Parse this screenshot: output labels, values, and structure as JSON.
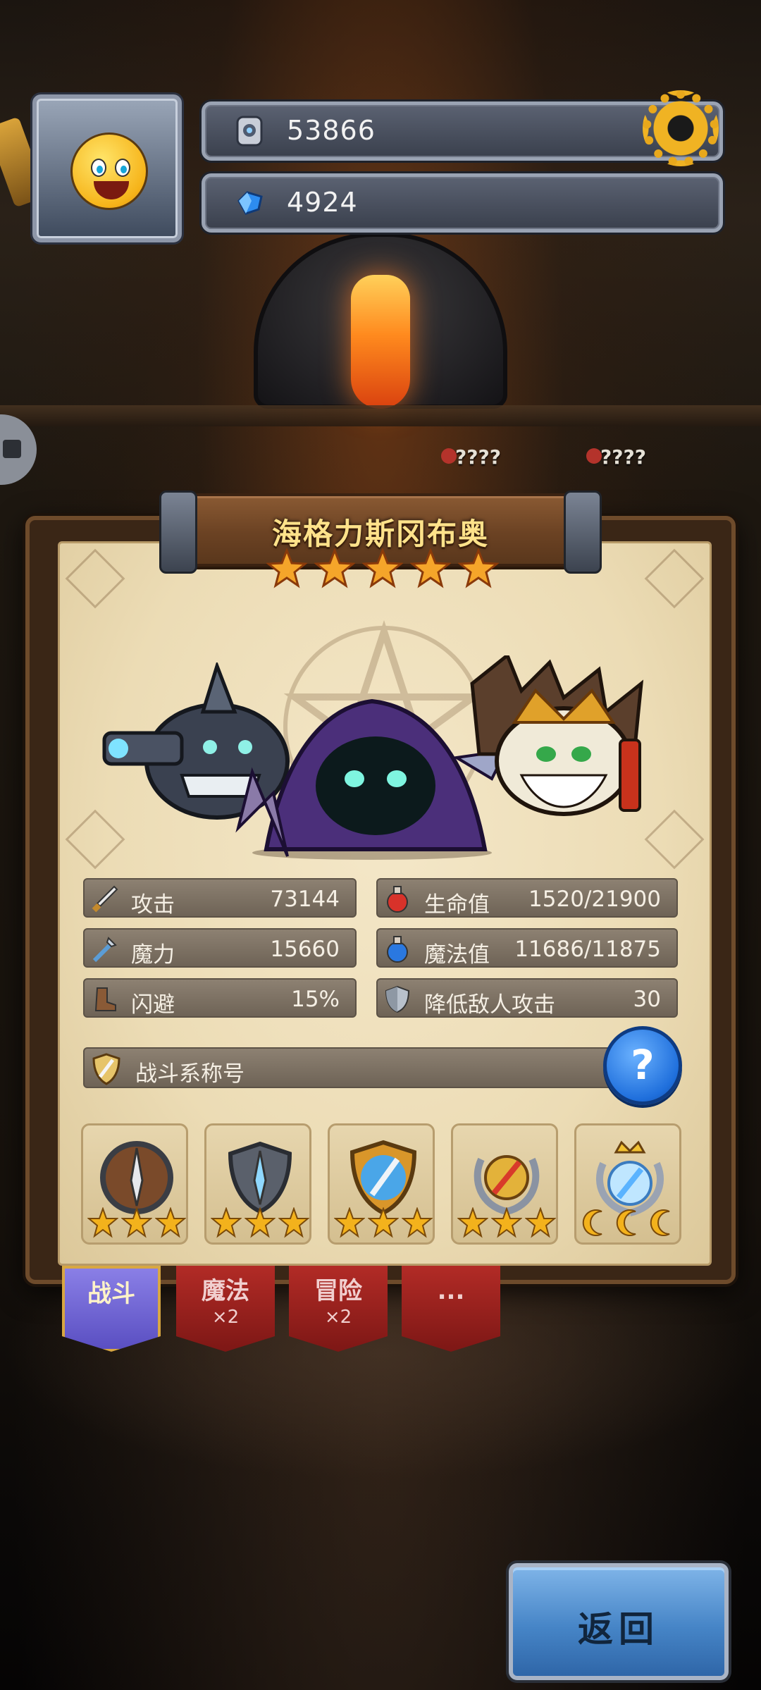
{
  "hud": {
    "currency_1": "53866",
    "currency_1_icon": "silver-token-icon",
    "currency_2": "4924",
    "currency_2_icon": "blue-crystal-icon"
  },
  "background_hints": [
    "????",
    "????"
  ],
  "hero": {
    "name": "海格力斯冈布奥",
    "stars": 5
  },
  "stats": [
    {
      "label": "攻击",
      "value": "73144",
      "icon": "sword-icon"
    },
    {
      "label": "生命值",
      "value": "1520/21900",
      "icon": "red-potion-icon"
    },
    {
      "label": "魔力",
      "value": "15660",
      "icon": "magic-staff-icon"
    },
    {
      "label": "魔法值",
      "value": "11686/11875",
      "icon": "blue-potion-icon"
    },
    {
      "label": "闪避",
      "value": "15%",
      "icon": "boot-icon"
    },
    {
      "label": "降低敌人攻击",
      "value": "30",
      "icon": "shield-icon"
    }
  ],
  "battle_title": {
    "label": "战斗系称号",
    "help": "?"
  },
  "badges": [
    {
      "emblem": "dagger-wood-shield-icon",
      "stars": 3,
      "star_type": "star"
    },
    {
      "emblem": "dagger-steel-shield-icon",
      "stars": 3,
      "star_type": "star"
    },
    {
      "emblem": "sword-gold-shield-icon",
      "stars": 3,
      "star_type": "star"
    },
    {
      "emblem": "sword-laurel-icon",
      "stars": 3,
      "star_type": "star"
    },
    {
      "emblem": "crowned-laurel-icon",
      "stars": 3,
      "star_type": "moon"
    }
  ],
  "tabs": [
    {
      "label": "战斗",
      "mult": "",
      "active": true
    },
    {
      "label": "魔法",
      "mult": "×2",
      "active": false
    },
    {
      "label": "冒险",
      "mult": "×2",
      "active": false
    },
    {
      "label": "...",
      "mult": "",
      "active": false
    }
  ],
  "return_label": "返回",
  "colors": {
    "parchment": "#ecdcb5",
    "stat_bar": "#7d7164",
    "star": "#f3b21c",
    "tab_active": "#6a5fd6",
    "tab_inactive": "#9c2420",
    "button_blue": "#4685c7"
  }
}
